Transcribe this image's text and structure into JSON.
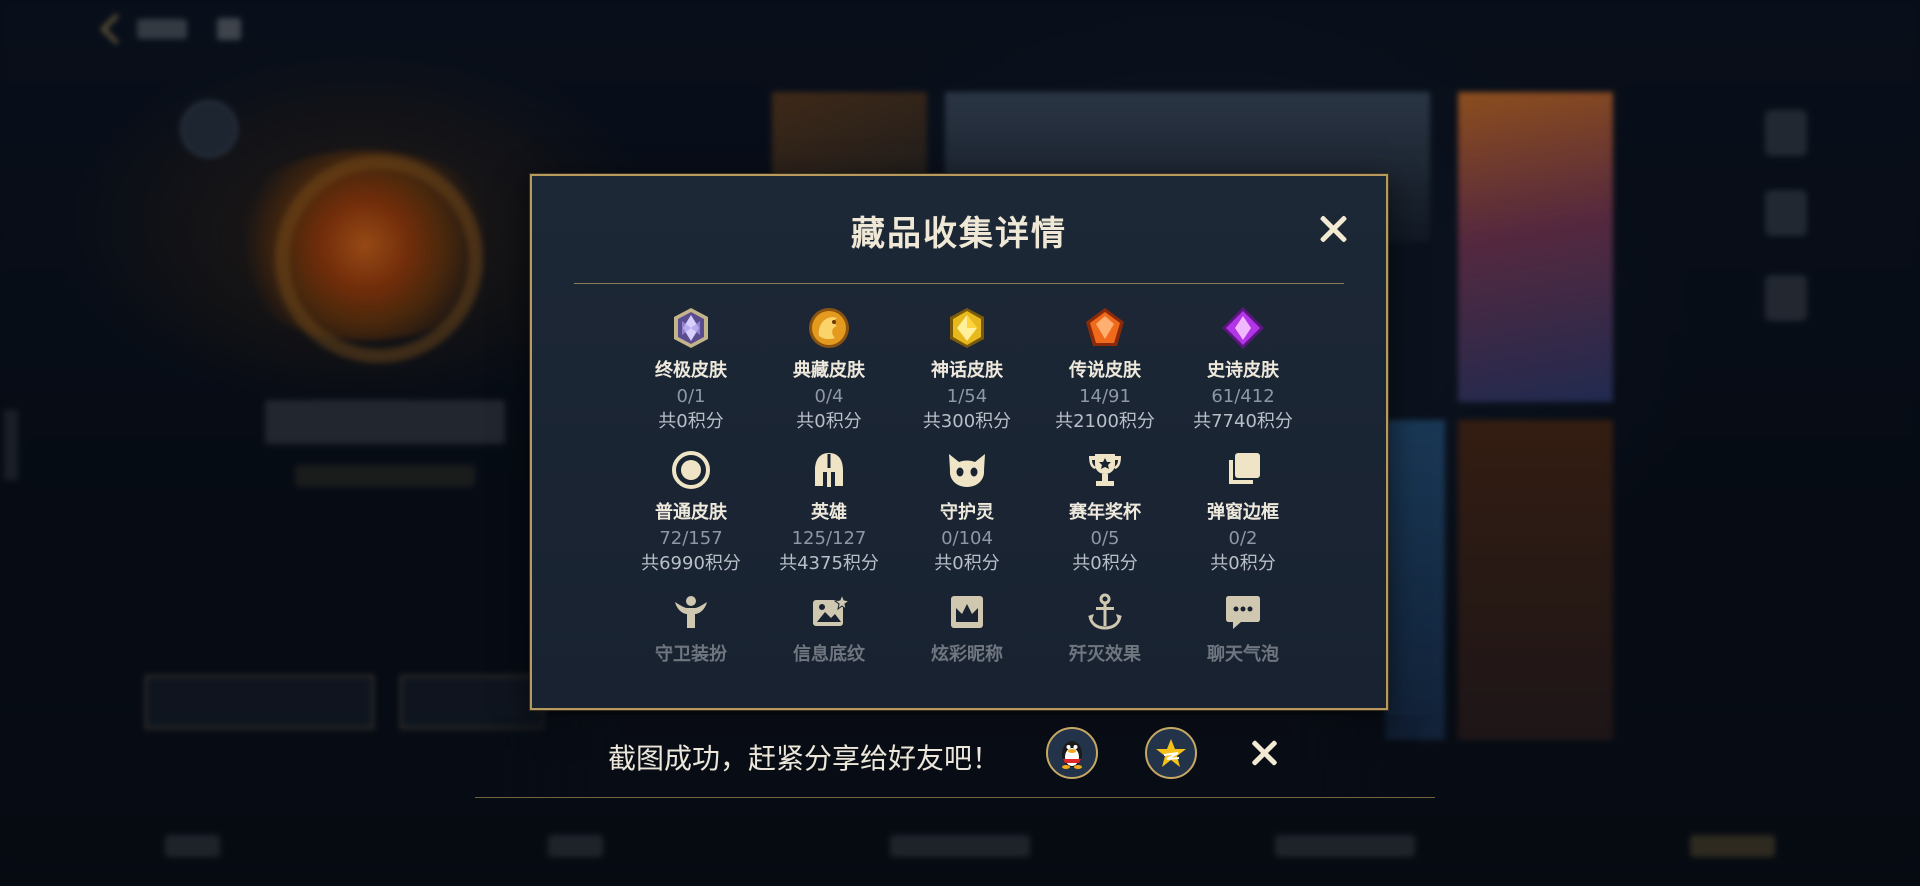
{
  "modal": {
    "title": "藏品收集详情",
    "items": [
      {
        "icon": "ultimate-skin-gem-icon",
        "name": "终极皮肤",
        "count": "0/1",
        "points": "共0积分"
      },
      {
        "icon": "collection-skin-dragon-icon",
        "name": "典藏皮肤",
        "count": "0/4",
        "points": "共0积分"
      },
      {
        "icon": "mythic-skin-gem-icon",
        "name": "神话皮肤",
        "count": "1/54",
        "points": "共300积分"
      },
      {
        "icon": "legendary-skin-gem-icon",
        "name": "传说皮肤",
        "count": "14/91",
        "points": "共2100积分"
      },
      {
        "icon": "epic-skin-gem-icon",
        "name": "史诗皮肤",
        "count": "61/412",
        "points": "共7740积分"
      },
      {
        "icon": "normal-skin-circle-icon",
        "name": "普通皮肤",
        "count": "72/157",
        "points": "共6990积分"
      },
      {
        "icon": "hero-helmet-icon",
        "name": "英雄",
        "count": "125/127",
        "points": "共4375积分"
      },
      {
        "icon": "guardian-spirit-icon",
        "name": "守护灵",
        "count": "0/104",
        "points": "共0积分"
      },
      {
        "icon": "season-trophy-icon",
        "name": "赛年奖杯",
        "count": "0/5",
        "points": "共0积分"
      },
      {
        "icon": "popup-frame-icon",
        "name": "弹窗边框",
        "count": "0/2",
        "points": "共0积分"
      },
      {
        "icon": "guardian-outfit-icon",
        "name": "守卫装扮"
      },
      {
        "icon": "info-background-icon",
        "name": "信息底纹"
      },
      {
        "icon": "colorful-nickname-icon",
        "name": "炫彩昵称"
      },
      {
        "icon": "annihilation-effect-icon",
        "name": "歼灭效果"
      },
      {
        "icon": "chat-bubble-icon",
        "name": "聊天气泡"
      }
    ]
  },
  "share": {
    "text": "截图成功，赶紧分享给好友吧！",
    "buttons": [
      {
        "icon": "qq-penguin-icon"
      },
      {
        "icon": "qzone-star-icon"
      }
    ]
  }
}
